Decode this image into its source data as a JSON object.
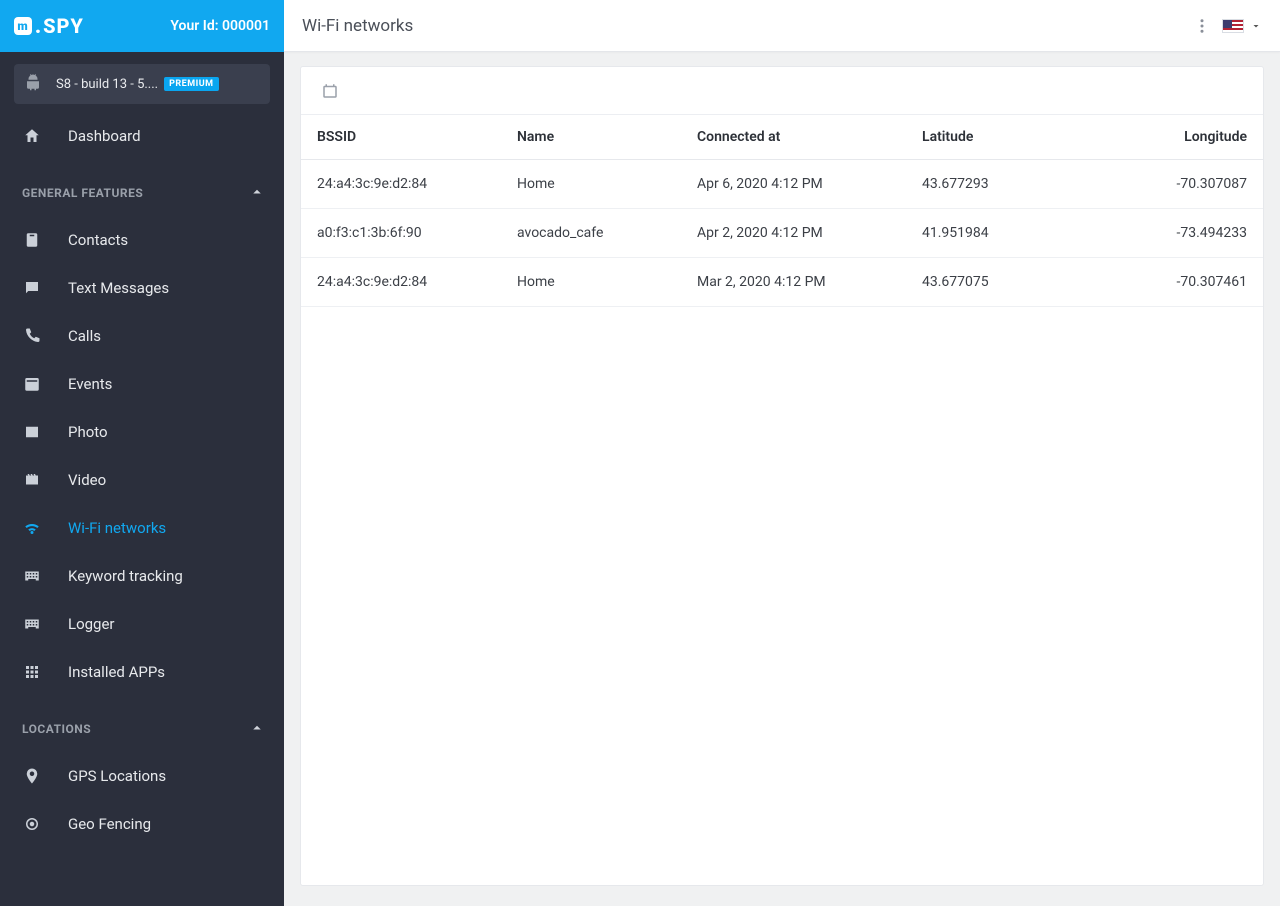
{
  "brand": {
    "name": "SPY"
  },
  "user": {
    "your_id_label": "Your Id: 000001"
  },
  "device": {
    "name": "S8 - build 13 - 5....",
    "badge": "PREMIUM"
  },
  "nav": {
    "dashboard": "Dashboard",
    "section_general": "GENERAL FEATURES",
    "items_general": [
      "Contacts",
      "Text Messages",
      "Calls",
      "Events",
      "Photo",
      "Video",
      "Wi-Fi networks",
      "Keyword tracking",
      "Logger",
      "Installed APPs"
    ],
    "section_locations": "LOCATIONS",
    "items_locations": [
      "GPS Locations",
      "Geo Fencing"
    ]
  },
  "page": {
    "title": "Wi-Fi networks"
  },
  "table": {
    "headers": {
      "bssid": "BSSID",
      "name": "Name",
      "connected": "Connected at",
      "lat": "Latitude",
      "lon": "Longitude"
    },
    "rows": [
      {
        "bssid": "24:a4:3c:9e:d2:84",
        "name": "Home",
        "connected": "Apr 6, 2020 4:12 PM",
        "lat": "43.677293",
        "lon": "-70.307087"
      },
      {
        "bssid": "a0:f3:c1:3b:6f:90",
        "name": "avocado_cafe",
        "connected": "Apr 2, 2020 4:12 PM",
        "lat": "41.951984",
        "lon": "-73.494233"
      },
      {
        "bssid": "24:a4:3c:9e:d2:84",
        "name": "Home",
        "connected": "Mar 2, 2020 4:12 PM",
        "lat": "43.677075",
        "lon": "-70.307461"
      }
    ]
  }
}
